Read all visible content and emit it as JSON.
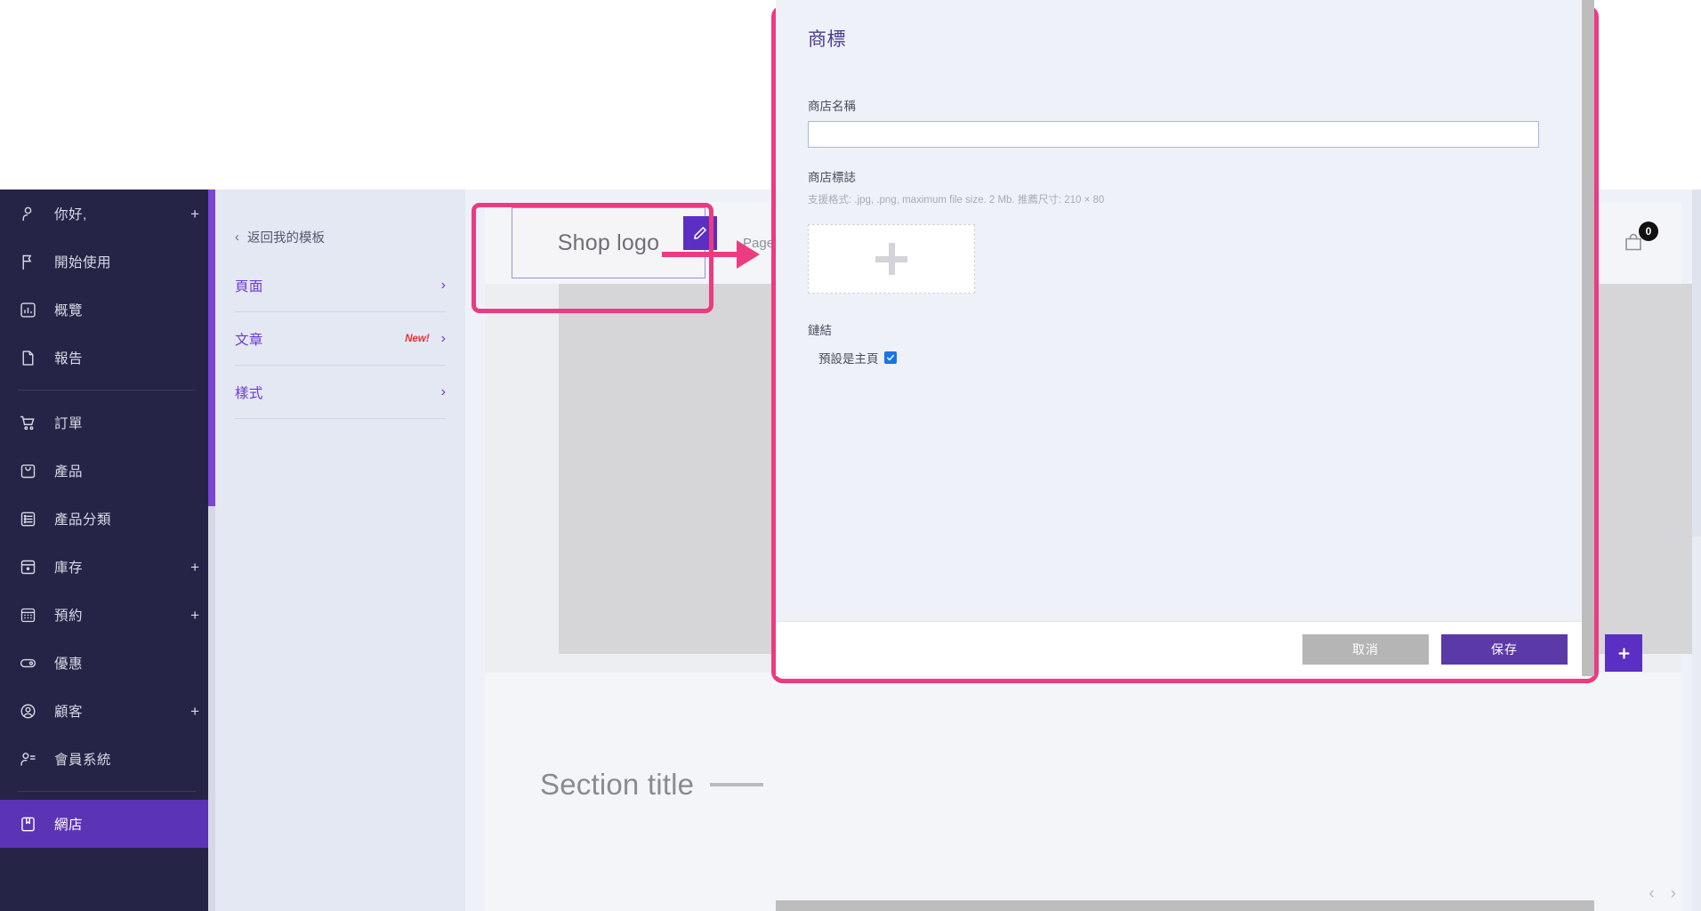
{
  "sidebar": {
    "items": [
      {
        "label": "你好,",
        "icon": "user-icon",
        "plus": "+",
        "active": false
      },
      {
        "label": "開始使用",
        "icon": "flag-icon",
        "plus": "",
        "active": false
      },
      {
        "label": "概覽",
        "icon": "chart-icon",
        "plus": "",
        "active": false
      },
      {
        "label": "報告",
        "icon": "document-icon",
        "plus": "",
        "active": false
      },
      {
        "label": "訂單",
        "icon": "cart-icon",
        "plus": "",
        "active": false
      },
      {
        "label": "產品",
        "icon": "bag-icon",
        "plus": "",
        "active": false
      },
      {
        "label": "產品分類",
        "icon": "list-icon",
        "plus": "",
        "active": false
      },
      {
        "label": "庫存",
        "icon": "inventory-icon",
        "plus": "+",
        "active": false
      },
      {
        "label": "預約",
        "icon": "calendar-icon",
        "plus": "+",
        "active": false
      },
      {
        "label": "優惠",
        "icon": "tag-icon",
        "plus": "",
        "active": false
      },
      {
        "label": "顧客",
        "icon": "customer-icon",
        "plus": "+",
        "active": false
      },
      {
        "label": "會員系統",
        "icon": "members-icon",
        "plus": "",
        "active": false
      },
      {
        "label": "網店",
        "icon": "store-icon",
        "plus": "",
        "active": true
      }
    ]
  },
  "panel": {
    "back_label": "返回我的模板",
    "back_chevron": "‹",
    "rows": [
      {
        "label": "頁面",
        "badge": "",
        "chevron": "›"
      },
      {
        "label": "文章",
        "badge": "New!",
        "chevron": "›"
      },
      {
        "label": "樣式",
        "badge": "",
        "chevron": "›"
      }
    ]
  },
  "canvas": {
    "logo_placeholder": "Shop logo",
    "nav_page": "Page A",
    "cart_badge": "0",
    "section_title": "Section title",
    "prev_arrow": "‹",
    "next_arrow": "›",
    "add_section_label": "+"
  },
  "modal": {
    "title": "商標",
    "shop_name_label": "商店名稱",
    "shop_name_value": "",
    "shop_name_placeholder": "",
    "shop_logo_label": "商店標誌",
    "shop_logo_help": "支援格式: .jpg, .png, maximum file size. 2 Mb. 推薦尺寸: 210 × 80",
    "upload_plus": "+",
    "link_label": "鏈結",
    "default_home_label": "預設是主頁",
    "default_home_checked": true,
    "cancel_label": "取消",
    "save_label": "保存"
  },
  "colors": {
    "sidebar_bg": "#262446",
    "sidebar_active": "#5b33b5",
    "accent_purple": "#5b2fc4",
    "highlight_pink": "#ec3b80",
    "panel_bg": "#e4e8f3",
    "panel_link": "#6d3bd1",
    "badge_new": "#ef2d2d",
    "save_button": "#5b3aa8",
    "cancel_button": "#b5b5b5",
    "modal_bg": "#eef1f8",
    "checkbox_blue": "#1a73e8"
  }
}
